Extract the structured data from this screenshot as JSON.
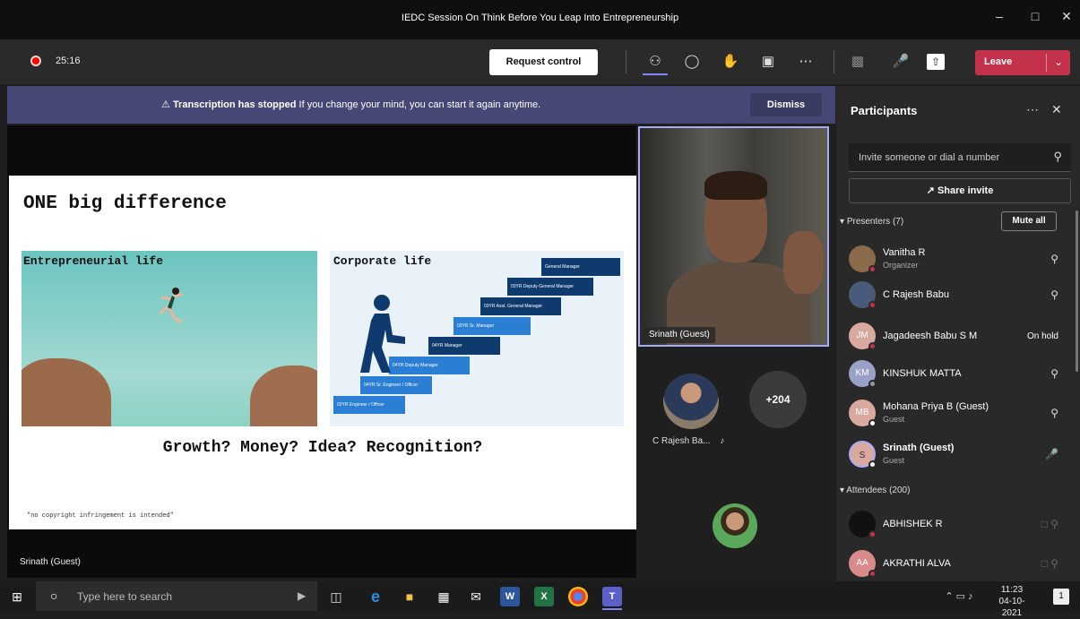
{
  "window": {
    "title": "IEDC Session On Think Before You Leap Into Entrepreneurship",
    "controls": [
      "–",
      "□",
      "✕"
    ]
  },
  "toolbar": {
    "timer": "25:16",
    "request_control": "Request control",
    "leave": "Leave",
    "icons": [
      "people-icon",
      "chat-icon",
      "reactions-icon",
      "rooms-icon",
      "more-icon",
      "camera-off-icon",
      "mic-off-icon",
      "share-tray-icon"
    ]
  },
  "banner": {
    "bold": "Transcription has stopped",
    "text": "If you change your mind, you can start it again anytime.",
    "dismiss": "Dismiss"
  },
  "slide": {
    "title": "ONE big difference",
    "left_label": "Entrepreneurial life",
    "right_label": "Corporate life",
    "question": "Growth? Money? Idea? Recognition?",
    "disclaimer": "\"no copyright infringement is intended\"",
    "stairs": [
      {
        "years": "02YR",
        "role": "Engineer / Officer"
      },
      {
        "years": "04YR",
        "role": "Sr. Engineer / Officer"
      },
      {
        "years": "04YR",
        "role": "Deputy Manager"
      },
      {
        "years": "04YR",
        "role": "Manager"
      },
      {
        "years": "03YR",
        "role": "Sr. Manager"
      },
      {
        "years": "03YR",
        "role": "Asst. General Manager"
      },
      {
        "years": "03YR",
        "role": "Deputy General Manager"
      },
      {
        "years": "",
        "role": "General Manager"
      }
    ]
  },
  "stage": {
    "presenter_label": "Srinath (Guest)"
  },
  "video": {
    "name": "Srinath (Guest)"
  },
  "tiles": {
    "tile1_name": "C Rajesh Ba...",
    "overflow_count": "+204"
  },
  "participants": {
    "title": "Participants",
    "invite_placeholder": "Invite someone or dial a number",
    "share_invite": "Share invite",
    "presenters_header": "Presenters (7)",
    "mute_all": "Mute all",
    "attendees_header": "Attendees (200)",
    "presenters": [
      {
        "initials": "",
        "name": "Vanitha R",
        "sub": "Organizer",
        "right": "mic-off-icon",
        "color": "#8a6a4a",
        "status": "#c4314b"
      },
      {
        "initials": "",
        "name": "C Rajesh Babu",
        "sub": "",
        "right": "mic-off-icon",
        "color": "#4a5a7a",
        "status": "#c4314b"
      },
      {
        "initials": "JM",
        "name": "Jagadeesh Babu S M",
        "sub": "",
        "right_text": "On hold",
        "color": "#d9a9a0",
        "status": "#c4314b"
      },
      {
        "initials": "KM",
        "name": "KINSHUK MATTA",
        "sub": "",
        "right": "mic-off-icon",
        "color": "#9aa0c8",
        "status": "#999999"
      },
      {
        "initials": "MB",
        "name": "Mohana Priya B (Guest)",
        "sub": "Guest",
        "right": "mic-off-icon",
        "color": "#d9a9a0",
        "status": "#ffffff"
      },
      {
        "initials": "S",
        "name": "Srinath (Guest)",
        "sub": "Guest",
        "right": "mic-on-icon",
        "color": "#d9a9a0",
        "status": "#ffffff"
      }
    ],
    "attendees": [
      {
        "initials": "",
        "name": "ABHISHEK R",
        "color": "#111111",
        "status": "#c4314b"
      },
      {
        "initials": "AA",
        "name": "AKRATHI ALVA",
        "color": "#d98a8a",
        "status": "#c4314b"
      }
    ]
  },
  "taskbar": {
    "search_placeholder": "Type here to search",
    "time": "11:23",
    "date": "04-10-2021",
    "notifications": "1"
  }
}
